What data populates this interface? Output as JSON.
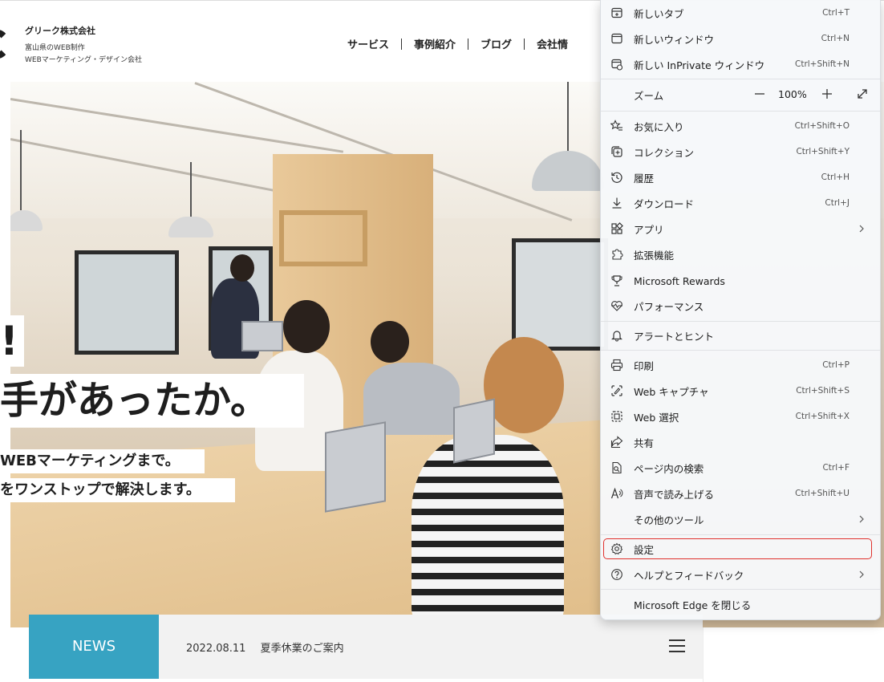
{
  "site": {
    "company_name": "グリーク株式会社",
    "company_desc_line1": "富山県のWEB制作",
    "company_desc_line2": "WEBマーケティング・デザイン会社",
    "nav": [
      "サービス",
      "事例紹介",
      "ブログ",
      "会社情"
    ]
  },
  "hero": {
    "line1": "!",
    "line2": "手があったか。",
    "line3": "WEBマーケティングまで。",
    "line4": "をワンストップで解決します。"
  },
  "news": {
    "label": "NEWS",
    "date": "2022.08.11",
    "title": "夏季休業のご案内"
  },
  "menu": {
    "new_tab": {
      "label": "新しいタブ",
      "shortcut": "Ctrl+T"
    },
    "new_window": {
      "label": "新しいウィンドウ",
      "shortcut": "Ctrl+N"
    },
    "new_inprivate": {
      "label": "新しい InPrivate ウィンドウ",
      "shortcut": "Ctrl+Shift+N"
    },
    "zoom": {
      "label": "ズーム",
      "value": "100%"
    },
    "favorites": {
      "label": "お気に入り",
      "shortcut": "Ctrl+Shift+O"
    },
    "collections": {
      "label": "コレクション",
      "shortcut": "Ctrl+Shift+Y"
    },
    "history": {
      "label": "履歴",
      "shortcut": "Ctrl+H"
    },
    "downloads": {
      "label": "ダウンロード",
      "shortcut": "Ctrl+J"
    },
    "apps": {
      "label": "アプリ"
    },
    "extensions": {
      "label": "拡張機能"
    },
    "rewards": {
      "label": "Microsoft Rewards"
    },
    "performance": {
      "label": "パフォーマンス"
    },
    "alerts": {
      "label": "アラートとヒント"
    },
    "print": {
      "label": "印刷",
      "shortcut": "Ctrl+P"
    },
    "web_capture": {
      "label": "Web キャプチャ",
      "shortcut": "Ctrl+Shift+S"
    },
    "web_select": {
      "label": "Web 選択",
      "shortcut": "Ctrl+Shift+X"
    },
    "share": {
      "label": "共有"
    },
    "find": {
      "label": "ページ内の検索",
      "shortcut": "Ctrl+F"
    },
    "read_aloud": {
      "label": "音声で読み上げる",
      "shortcut": "Ctrl+Shift+U"
    },
    "more_tools": {
      "label": "その他のツール"
    },
    "settings": {
      "label": "設定"
    },
    "help": {
      "label": "ヘルプとフィードバック"
    },
    "close": {
      "label": "Microsoft Edge を閉じる"
    }
  },
  "colors": {
    "news_accent": "#37a3c2",
    "highlight": "#e0302c"
  }
}
